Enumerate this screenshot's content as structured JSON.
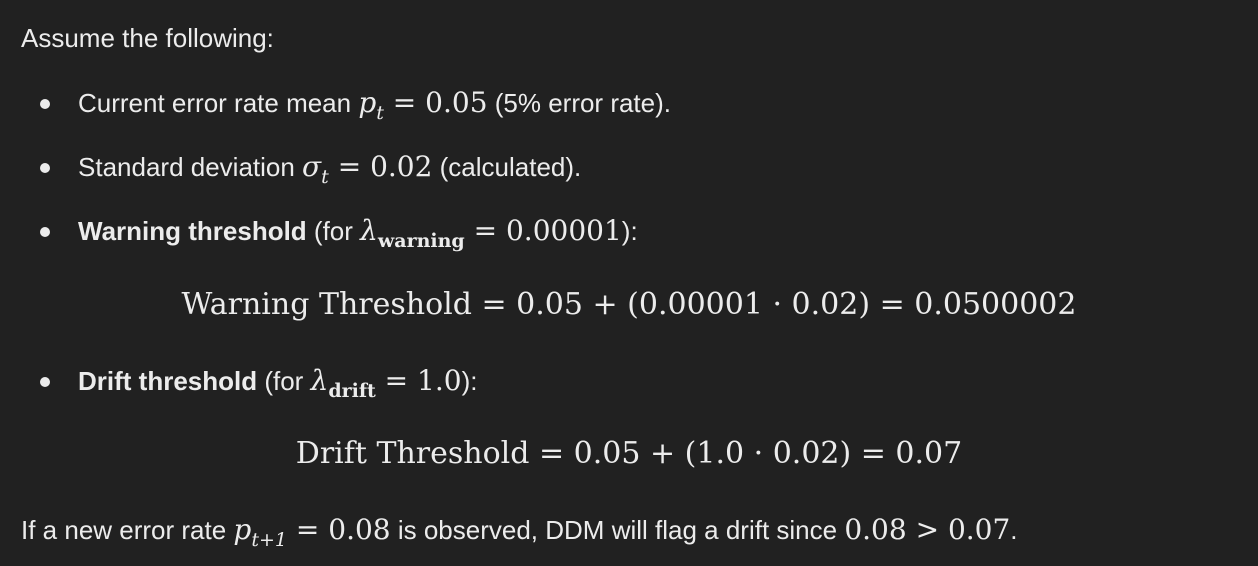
{
  "intro": "Assume the following:",
  "items": [
    {
      "pre": "Current error rate mean ",
      "math_var": "p",
      "math_sub": "t",
      "math_rest": " = 0.05",
      "post": " (5% error rate)."
    },
    {
      "pre": "Standard deviation ",
      "math_var": "σ",
      "math_sub": "t",
      "math_rest": " = 0.02",
      "post": " (calculated)."
    },
    {
      "bold": "Warning threshold",
      "pre": " (for ",
      "math_var": "λ",
      "math_sub": "warning",
      "math_rest": " = 0.00001",
      "post": "):"
    },
    {
      "bold": "Drift threshold",
      "pre": " (for ",
      "math_var": "λ",
      "math_sub": "drift",
      "math_rest": " = 1.0",
      "post": "):"
    }
  ],
  "equations": {
    "warning": "Warning Threshold = 0.05 + (0.00001 · 0.02) = 0.0500002",
    "drift": "Drift Threshold = 0.05 + (1.0 · 0.02) = 0.07"
  },
  "conclusion": {
    "pre": "If a new error rate ",
    "math_var": "p",
    "math_sub": "t+1",
    "math_rest": " = 0.08",
    "mid": " is observed, DDM will flag a drift since ",
    "math_end": "0.08 > 0.07",
    "post": "."
  }
}
